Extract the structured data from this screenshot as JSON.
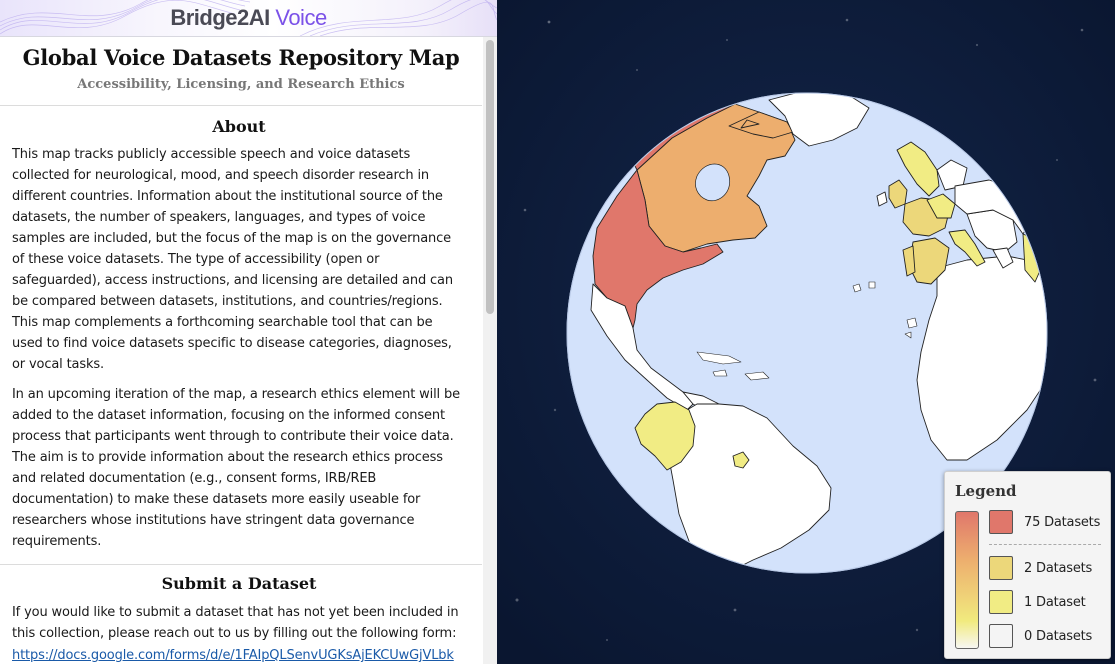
{
  "brand": {
    "part1": "Bridge2AI",
    "part2": "Voice"
  },
  "header": {
    "title": "Global Voice Datasets Repository Map",
    "subtitle": "Accessibility, Licensing, and Research Ethics"
  },
  "about": {
    "heading": "About",
    "paragraph1": "This map tracks publicly accessible speech and voice datasets collected for neurological, mood, and speech disorder research in different countries. Information about the institutional source of the datasets, the number of speakers, languages, and types of voice samples are included, but the focus of the map is on the governance of these voice datasets. The type of accessibility (open or safeguarded), access instructions, and licensing are detailed and can be compared between datasets, institutions, and countries/regions. This map complements a forthcoming searchable tool that can be used to find voice datasets specific to disease categories, diagnoses, or vocal tasks.",
    "paragraph2": "In an upcoming iteration of the map, a research ethics element will be added to the dataset information, focusing on the informed consent process that participants went through to contribute their voice data. The aim is to provide information about the research ethics process and related documentation (e.g., consent forms, IRB/REB documentation) to make these datasets more easily useable for researchers whose institutions have stringent data governance requirements."
  },
  "submit": {
    "heading": "Submit a Dataset",
    "paragraph": "If you would like to submit a dataset that has not yet been included in this collection, please reach out to us by filling out the following form:",
    "link_text": "https://docs.google.com/forms/d/e/1FAIpQLSenvUGKsAjEKCUwGjVLbk"
  },
  "legend": {
    "title": "Legend",
    "items": [
      {
        "label": "75 Datasets",
        "color": "#e0776b"
      },
      {
        "label": "2 Datasets",
        "color": "#ecd77a"
      },
      {
        "label": "1 Dataset",
        "color": "#f1ec84"
      },
      {
        "label": "0 Datasets",
        "color": "#f4f4f4"
      }
    ]
  },
  "map": {
    "colors": {
      "ocean": "#d3e2fb",
      "space": "#0c1a33",
      "usa": "#e0776b",
      "canada": "#edae6e",
      "europe_high": "#ecd77a",
      "one_dataset": "#f1ec84",
      "no_data": "#ffffff"
    },
    "icons": [
      "globe-map"
    ]
  }
}
